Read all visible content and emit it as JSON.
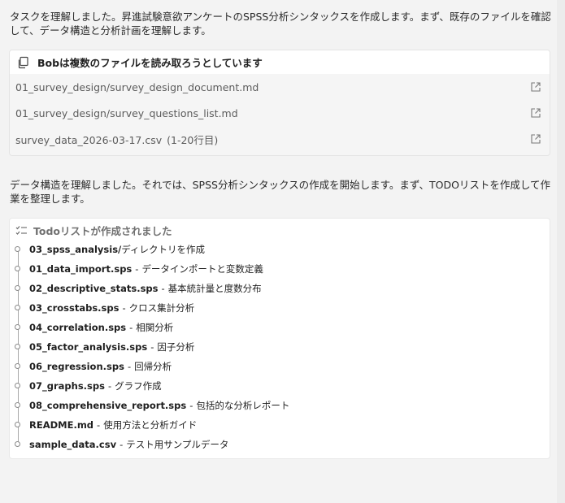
{
  "messages": {
    "intro": "タスクを理解しました。昇進試験意欲アンケートのSPSS分析シンタックスを作成します。まず、既存のファイルを確認して、データ構造と分析計画を理解します。",
    "followup": "データ構造を理解しました。それでは、SPSS分析シンタックスの作成を開始します。まず、TODOリストを作成して作業を整理します。"
  },
  "file_read": {
    "icon": "copy-icon",
    "title": "Bobは複数のファイルを読み取ろうとしています",
    "files": [
      {
        "name": "01_survey_design/survey_design_document.md",
        "range": ""
      },
      {
        "name": "01_survey_design/survey_questions_list.md",
        "range": ""
      },
      {
        "name": "survey_data_2026-03-17.csv",
        "range": "(1-20行目)"
      }
    ]
  },
  "todo": {
    "icon": "checklist-icon",
    "title": "Todoリストが作成されました",
    "separator": "-",
    "items": [
      {
        "file": "03_spss_analysis/",
        "desc": "ディレクトリを作成",
        "plain": true
      },
      {
        "file": "01_data_import.sps",
        "desc": "データインポートと変数定義"
      },
      {
        "file": "02_descriptive_stats.sps",
        "desc": "基本統計量と度数分布"
      },
      {
        "file": "03_crosstabs.sps",
        "desc": "クロス集計分析"
      },
      {
        "file": "04_correlation.sps",
        "desc": "相関分析"
      },
      {
        "file": "05_factor_analysis.sps",
        "desc": "因子分析"
      },
      {
        "file": "06_regression.sps",
        "desc": "回帰分析"
      },
      {
        "file": "07_graphs.sps",
        "desc": "グラフ作成"
      },
      {
        "file": "08_comprehensive_report.sps",
        "desc": "包括的な分析レポート"
      },
      {
        "file": "README.md",
        "desc": "使用方法と分析ガイド"
      },
      {
        "file": "sample_data.csv",
        "desc": "テスト用サンプルデータ"
      }
    ]
  }
}
